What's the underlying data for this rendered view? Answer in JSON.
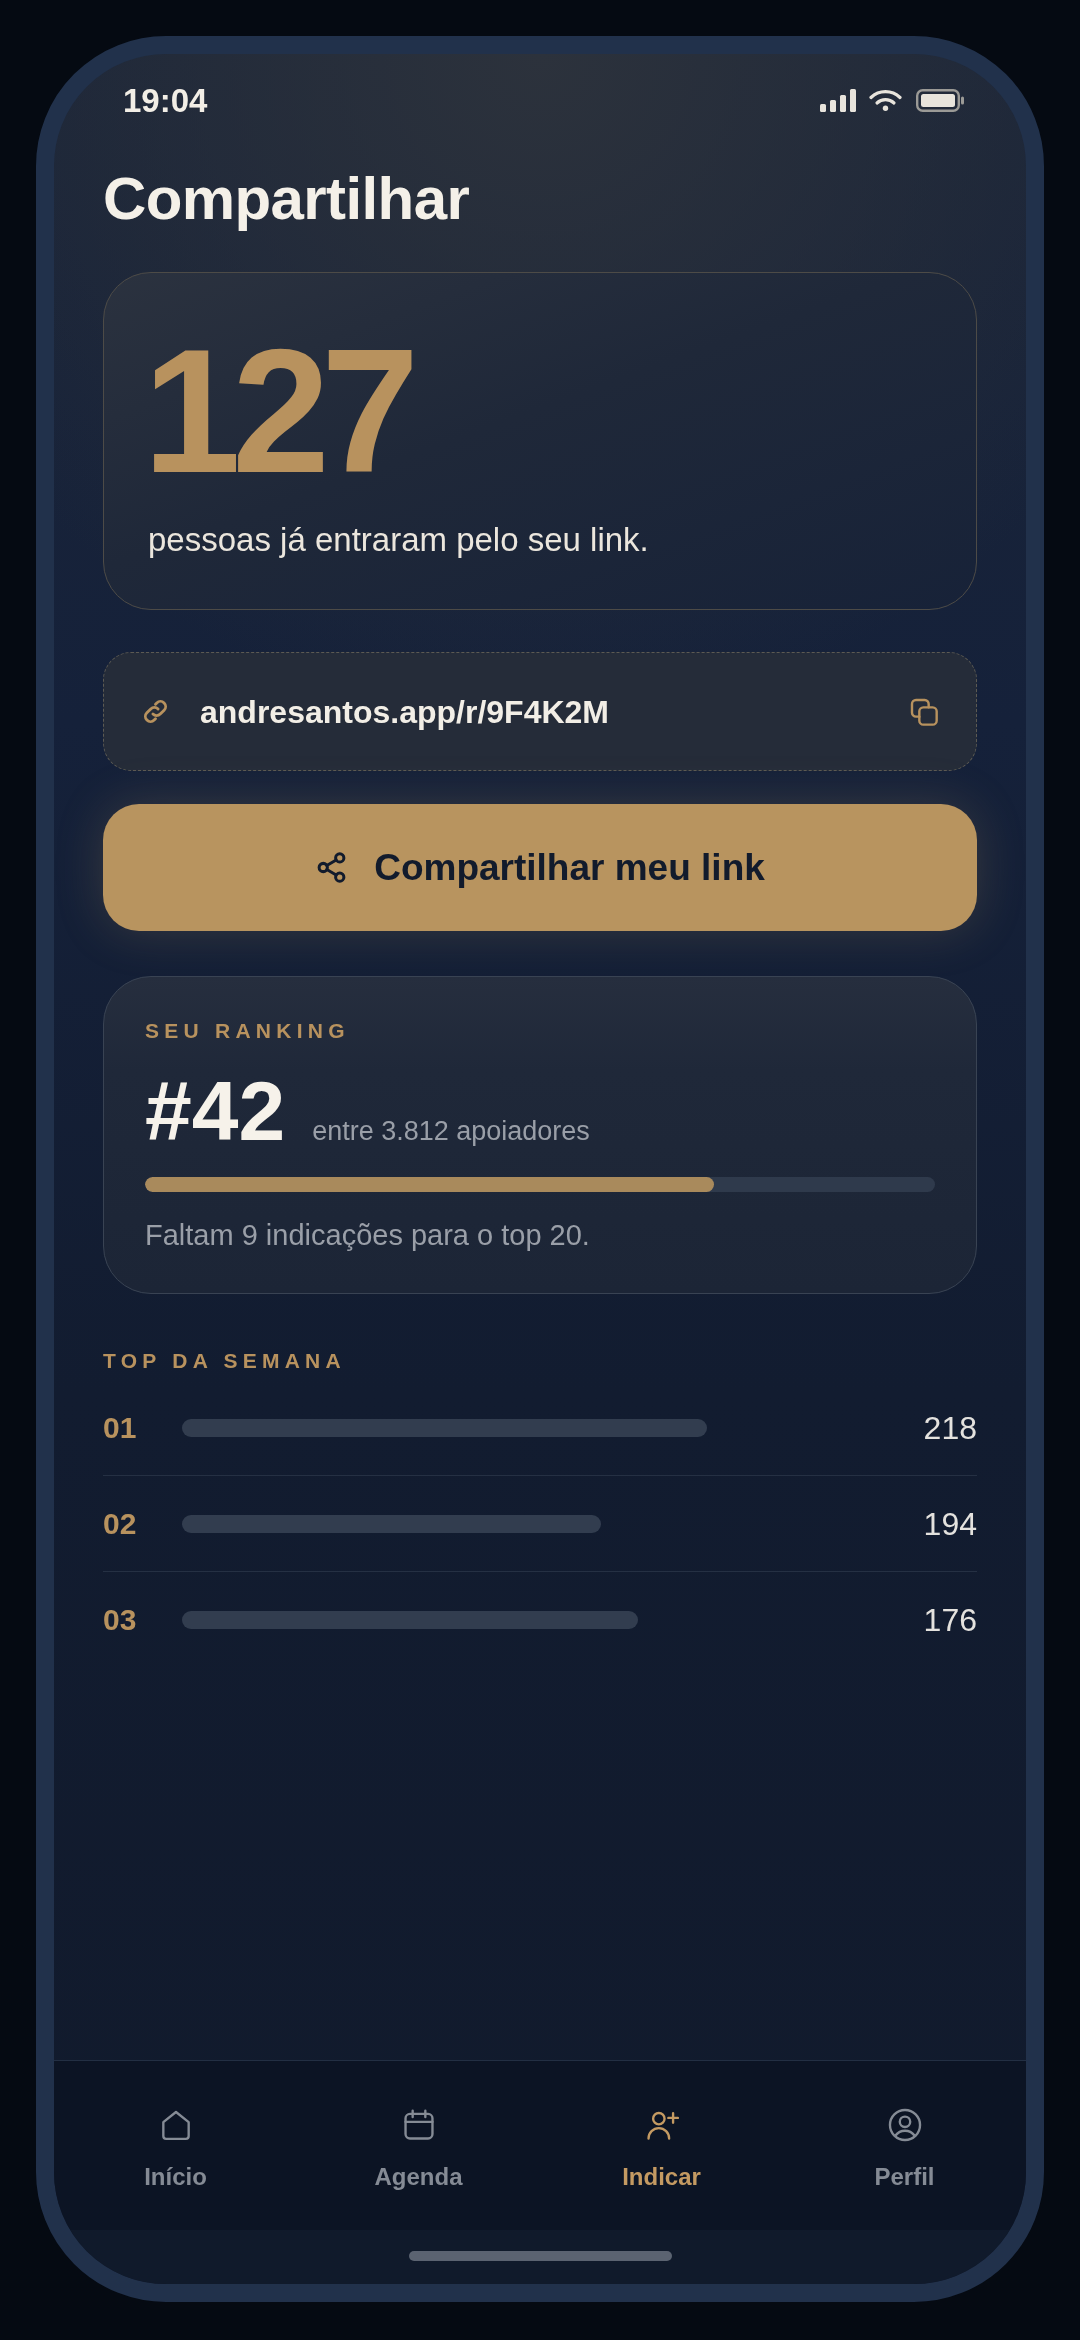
{
  "status_bar": {
    "time": "19:04"
  },
  "title": "Compartilhar",
  "referrals_card": {
    "count": "127",
    "caption": "pessoas já entraram pelo seu link."
  },
  "link_field": {
    "value": "andresantos.app/r/9F4K2M"
  },
  "share_button": {
    "label": "Compartilhar meu link"
  },
  "ranking": {
    "heading": "SEU RANKING",
    "position": "#42",
    "subtitle": "entre 3.812 apoiadores",
    "level": 0.72,
    "note": "Faltam 9 indicações para o top 20."
  },
  "top_week": {
    "heading": "TOP DA SEMANA",
    "rows": [
      {
        "rank": "01",
        "value": "218"
      },
      {
        "rank": "02",
        "value": "194"
      },
      {
        "rank": "03",
        "value": "176"
      }
    ]
  },
  "nav": [
    {
      "label": "Início",
      "selected": false
    },
    {
      "label": "Agenda",
      "selected": false
    },
    {
      "label": "Indicar",
      "selected": true
    },
    {
      "label": "Perfil",
      "selected": false
    }
  ]
}
